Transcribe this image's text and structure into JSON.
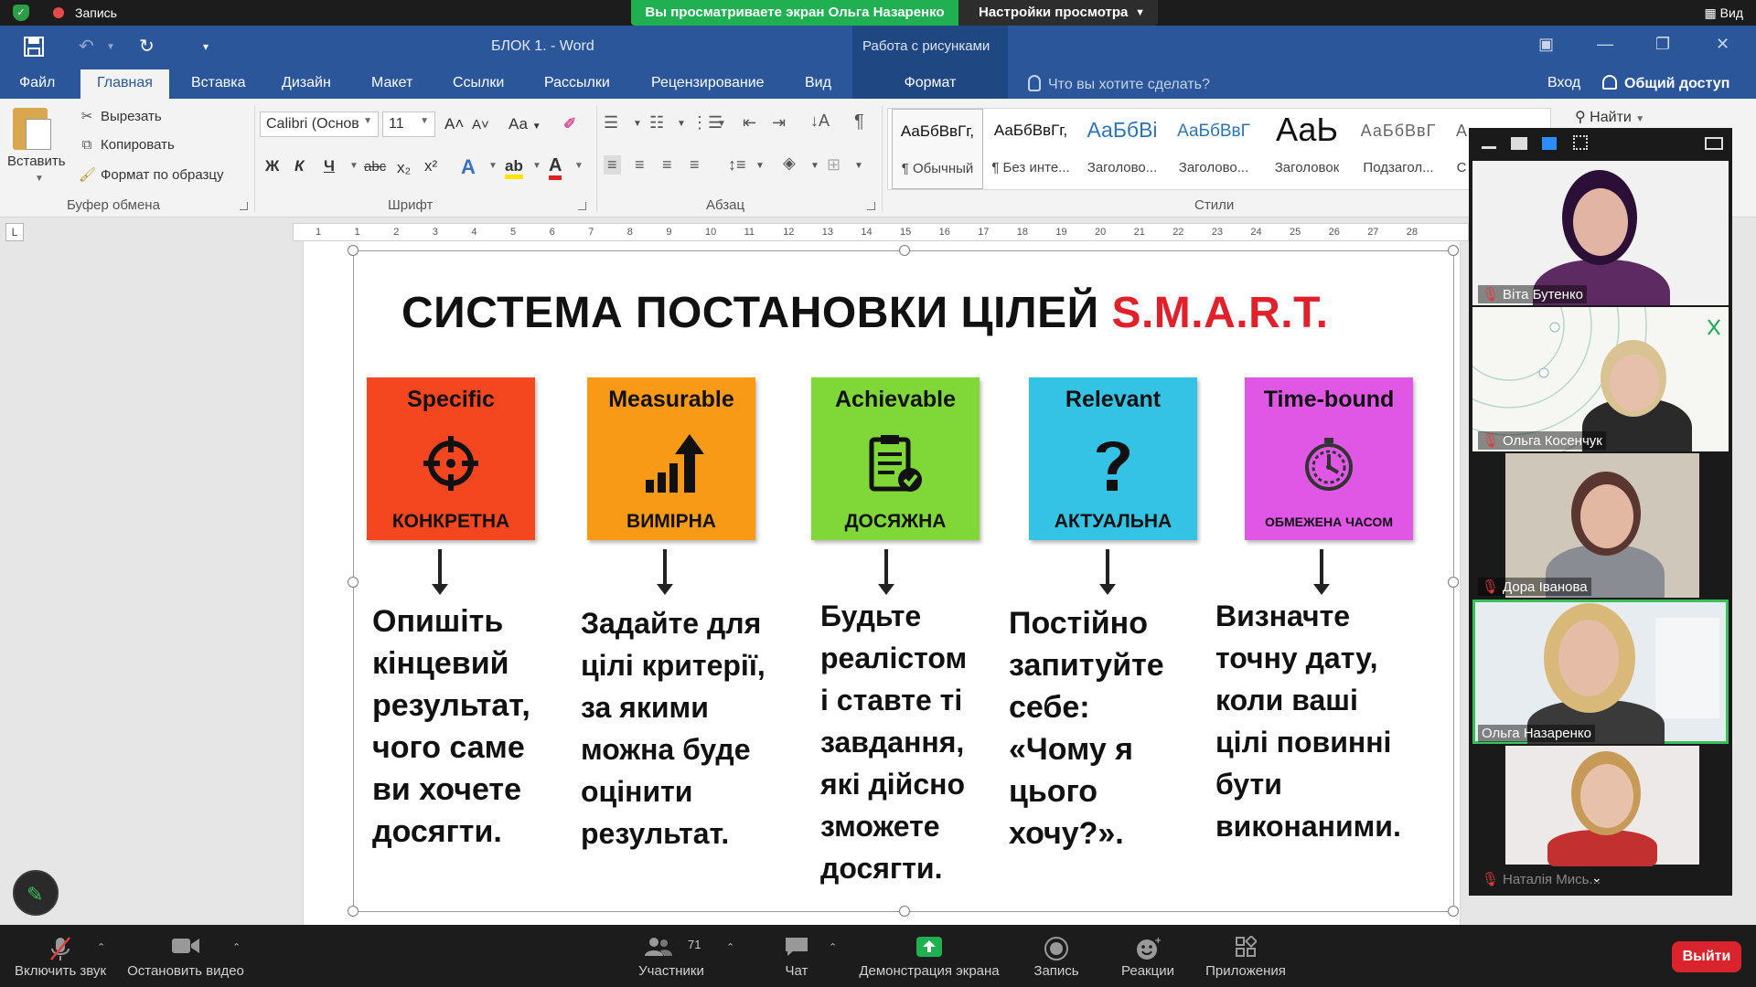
{
  "zoom_top": {
    "recording_label": "Запись",
    "share_banner": "Вы просматриваете экран Ольга Назаренко",
    "view_settings": "Настройки просмотра",
    "view_button": "Вид"
  },
  "word": {
    "doc_title": "БЛОК 1. - Word",
    "context_group": "Работа с рисунками",
    "tabs": [
      "Файл",
      "Главная",
      "Вставка",
      "Дизайн",
      "Макет",
      "Ссылки",
      "Рассылки",
      "Рецензирование",
      "Вид"
    ],
    "context_tab": "Формат",
    "tell_me": "Что вы хотите сделать?",
    "login": "Вход",
    "share": "Общий доступ",
    "clipboard": {
      "paste": "Вставить",
      "cut": "Вырезать",
      "copy": "Копировать",
      "format_painter": "Формат по образцу",
      "group": "Буфер обмена"
    },
    "font": {
      "name": "Calibri (Основ",
      "size": "11",
      "group": "Шрифт",
      "case_btn": "Аа"
    },
    "paragraph": {
      "group": "Абзац"
    },
    "styles": {
      "group": "Стили",
      "items": [
        {
          "sample": "АаБбВвГг,",
          "name": "¶ Обычный"
        },
        {
          "sample": "АаБбВвГг,",
          "name": "¶ Без инте..."
        },
        {
          "sample": "АаБбВі",
          "name": "Заголово..."
        },
        {
          "sample": "АаБбВвГ",
          "name": "Заголово..."
        },
        {
          "sample": "АаЬ",
          "name": "Заголовок"
        },
        {
          "sample": "АаБбВвГ",
          "name": "Подзагол..."
        },
        {
          "sample": "А",
          "name": "С"
        }
      ]
    },
    "find": "Найти"
  },
  "ruler": {
    "corner": "L",
    "marks": [
      "1",
      "1",
      "2",
      "3",
      "4",
      "5",
      "6",
      "7",
      "8",
      "9",
      "10",
      "11",
      "12",
      "13",
      "14",
      "15",
      "16",
      "17",
      "18",
      "19",
      "20",
      "21",
      "22",
      "23",
      "24",
      "25",
      "26",
      "27",
      "28"
    ]
  },
  "document": {
    "title_main": "СИСТЕМА ПОСТАНОВКИ ЦІЛЕЙ",
    "title_accent": "S.M.A.R.T.",
    "cards": [
      {
        "eng": "Specific",
        "ukr": "КОНКРЕТНА",
        "color": "#f4471f",
        "icon": "crosshair-icon"
      },
      {
        "eng": "Measurable",
        "ukr": "ВИМІРНА",
        "color": "#f99a17",
        "icon": "growth-chart-icon"
      },
      {
        "eng": "Achievable",
        "ukr": "ДОСЯЖНА",
        "color": "#7fd838",
        "icon": "clipboard-check-icon"
      },
      {
        "eng": "Relevant",
        "ukr": "АКТУАЛЬНА",
        "color": "#34c3e4",
        "icon": "question-mark-icon"
      },
      {
        "eng": "Time-bound",
        "ukr": "ОБМЕЖЕНА ЧАСОМ",
        "color": "#e057e6",
        "icon": "stopwatch-icon"
      }
    ],
    "descriptions": [
      [
        "Опишіть",
        "кінцевий",
        "результат,",
        "чого саме",
        "ви хочете",
        "досягти."
      ],
      [
        "Задайте для",
        "цілі критерії,",
        "за якими",
        "можна буде",
        "оцінити",
        "результат."
      ],
      [
        "Будьте",
        "реалістом",
        "і ставте  ті",
        "завдання,",
        "які дійсно",
        "зможете",
        "досягти."
      ],
      [
        "Постійно",
        "запитуйте",
        "себе:",
        "«Чому я",
        "цього",
        "хочу?»."
      ],
      [
        "Визначте",
        "точну дату,",
        "коли ваші",
        "цілі повинні",
        "бути",
        "виконаними."
      ]
    ]
  },
  "participants": [
    {
      "name": "Віта Бутенко",
      "muted": true
    },
    {
      "name": "Ольга Косенчук",
      "muted": true
    },
    {
      "name": "Дора Іванова",
      "muted": true
    },
    {
      "name": "Ольга Назаренко",
      "muted": false,
      "active": true
    },
    {
      "name": "Наталія Мись...",
      "muted": true
    }
  ],
  "zoom_bottom": {
    "unmute": "Включить звук",
    "stop_video": "Остановить видео",
    "participants": "Участники",
    "participants_count": "71",
    "chat": "Чат",
    "share_screen": "Демонстрация экрана",
    "record": "Запись",
    "reactions": "Реакции",
    "apps": "Приложения",
    "leave": "Выйти"
  },
  "colors": {
    "word_blue": "#2b579a",
    "zoom_green": "#20b052",
    "smart_red": "#e0202a"
  }
}
